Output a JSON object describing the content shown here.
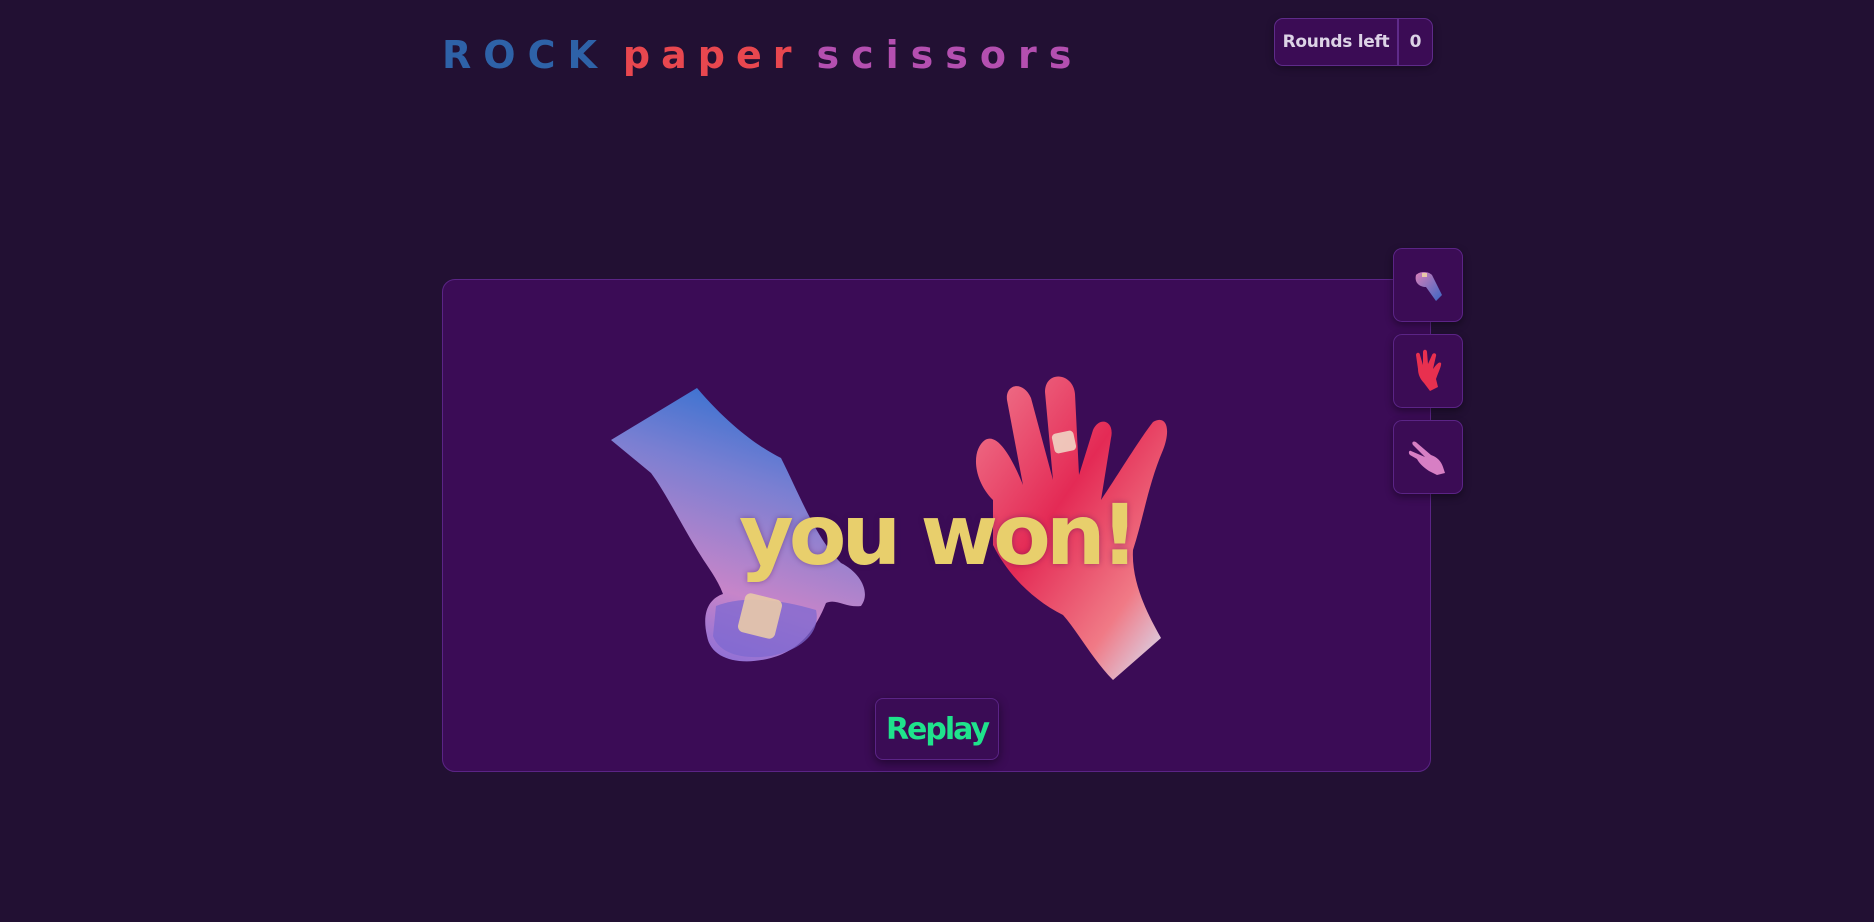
{
  "header": {
    "title_parts": [
      "ROCK",
      "paper",
      "scissors"
    ],
    "title_colors": [
      "#2e62a8",
      "#e8474f",
      "#b44fb0"
    ],
    "rounds_label": "Rounds left",
    "rounds_count": "0"
  },
  "board": {
    "result_text": "you won!",
    "result_color": "#e8cf6c",
    "replay_label": "Replay",
    "replay_color": "#1fe38c",
    "player_hand": "rock-hand",
    "opponent_hand": "paper-hand"
  },
  "choices": [
    {
      "name": "rock",
      "icon": "rock-hand-icon"
    },
    {
      "name": "paper",
      "icon": "paper-hand-icon"
    },
    {
      "name": "scissors",
      "icon": "scissors-hand-icon"
    }
  ]
}
